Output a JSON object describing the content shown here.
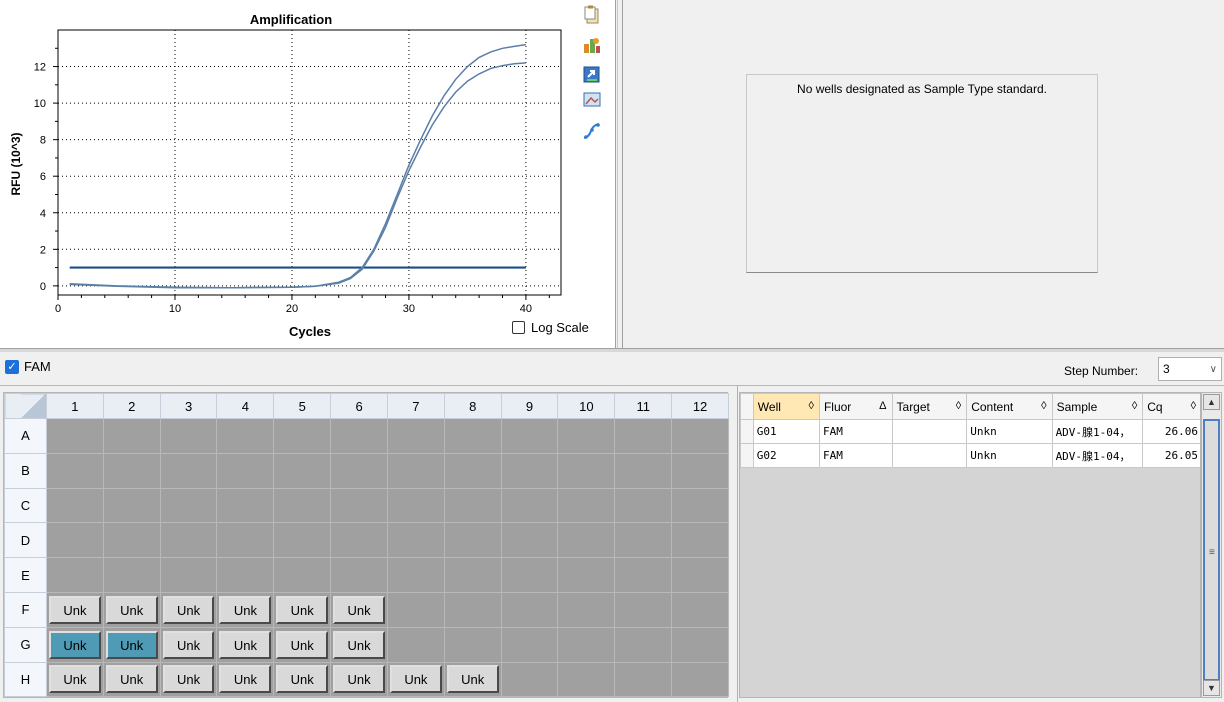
{
  "amplification_panel": {
    "title": "Amplification",
    "xlabel": "Cycles",
    "ylabel": "RFU (10^3)",
    "x_ticks": [
      "0",
      "10",
      "20",
      "30",
      "40"
    ],
    "y_ticks": [
      "0",
      "2",
      "4",
      "6",
      "8",
      "10",
      "12"
    ],
    "log_scale_label": "Log Scale",
    "log_scale_checked": false,
    "toolbar_icons": [
      "copy-icon",
      "chart-properties-icon",
      "export-icon",
      "image-icon",
      "curve-icon"
    ]
  },
  "chart_data": {
    "type": "line",
    "title": "Amplification",
    "xlabel": "Cycles",
    "ylabel": "RFU (10^3)",
    "xlim": [
      0,
      43
    ],
    "ylim": [
      -0.5,
      14
    ],
    "grid": true,
    "series": [
      {
        "x": [
          1,
          5,
          10,
          15,
          20,
          22,
          24,
          25,
          26,
          27,
          28,
          29,
          30,
          31,
          32,
          33,
          34,
          35,
          36,
          37,
          38,
          39,
          40
        ],
        "y": [
          0.12,
          0.0,
          -0.08,
          -0.1,
          -0.08,
          -0.02,
          0.2,
          0.45,
          1.0,
          2.0,
          3.4,
          5.0,
          6.6,
          8.0,
          9.3,
          10.4,
          11.3,
          12.0,
          12.5,
          12.8,
          13.0,
          13.1,
          13.2
        ],
        "color": "#5a7fa8"
      },
      {
        "x": [
          1,
          5,
          10,
          15,
          20,
          22,
          24,
          25,
          26,
          27,
          28,
          29,
          30,
          31,
          32,
          33,
          34,
          35,
          36,
          37,
          38,
          39,
          40
        ],
        "y": [
          0.08,
          -0.02,
          -0.1,
          -0.1,
          -0.08,
          -0.02,
          0.15,
          0.4,
          0.9,
          1.9,
          3.2,
          4.8,
          6.3,
          7.6,
          8.8,
          9.8,
          10.6,
          11.2,
          11.6,
          11.9,
          12.05,
          12.15,
          12.2
        ],
        "color": "#5a7fa8"
      }
    ],
    "threshold": {
      "y": 1.0,
      "x_start": 1,
      "x_end": 40,
      "color": "#1f4e86"
    }
  },
  "standard_curve_panel": {
    "message": "No wells designated as Sample Type standard."
  },
  "fluor_bar": {
    "fam_label": "FAM",
    "fam_checked": true,
    "step_label": "Step Number:",
    "step_value": "3"
  },
  "plate": {
    "columns": [
      "1",
      "2",
      "3",
      "4",
      "5",
      "6",
      "7",
      "8",
      "9",
      "10",
      "11",
      "12"
    ],
    "rows": [
      {
        "label": "A",
        "wells": [
          "",
          "",
          "",
          "",
          "",
          "",
          "",
          "",
          "",
          "",
          "",
          ""
        ]
      },
      {
        "label": "B",
        "wells": [
          "",
          "",
          "",
          "",
          "",
          "",
          "",
          "",
          "",
          "",
          "",
          ""
        ]
      },
      {
        "label": "C",
        "wells": [
          "",
          "",
          "",
          "",
          "",
          "",
          "",
          "",
          "",
          "",
          "",
          ""
        ]
      },
      {
        "label": "D",
        "wells": [
          "",
          "",
          "",
          "",
          "",
          "",
          "",
          "",
          "",
          "",
          "",
          ""
        ]
      },
      {
        "label": "E",
        "wells": [
          "",
          "",
          "",
          "",
          "",
          "",
          "",
          "",
          "",
          "",
          "",
          ""
        ]
      },
      {
        "label": "F",
        "wells": [
          "Unk",
          "Unk",
          "Unk",
          "Unk",
          "Unk",
          "Unk",
          "",
          "",
          "",
          "",
          "",
          ""
        ]
      },
      {
        "label": "G",
        "wells": [
          "Unk",
          "Unk",
          "Unk",
          "Unk",
          "Unk",
          "Unk",
          "",
          "",
          "",
          "",
          "",
          ""
        ],
        "selected": [
          0,
          1
        ]
      },
      {
        "label": "H",
        "wells": [
          "Unk",
          "Unk",
          "Unk",
          "Unk",
          "Unk",
          "Unk",
          "Unk",
          "Unk",
          "",
          "",
          "",
          ""
        ]
      }
    ]
  },
  "results_table": {
    "headers": [
      {
        "label": "Well",
        "sort": "◊"
      },
      {
        "label": "Fluor",
        "sort": "Δ"
      },
      {
        "label": "Target",
        "sort": "◊"
      },
      {
        "label": "Content",
        "sort": "◊"
      },
      {
        "label": "Sample",
        "sort": "◊"
      },
      {
        "label": "Cq",
        "sort": "◊"
      }
    ],
    "rows": [
      [
        "G01",
        "FAM",
        "",
        "Unkn",
        "ADV-腺1-04，",
        "26.06"
      ],
      [
        "G02",
        "FAM",
        "",
        "Unkn",
        "ADV-腺1-04，",
        "26.05"
      ]
    ]
  }
}
